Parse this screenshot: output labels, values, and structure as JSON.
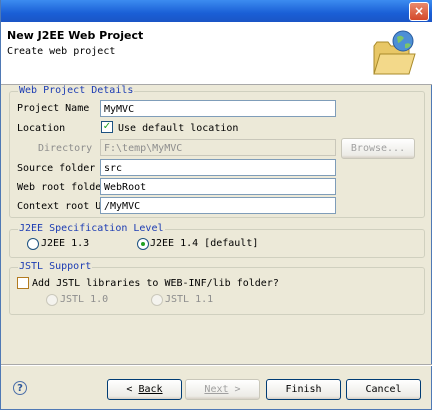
{
  "header": {
    "title": "New J2EE Web Project",
    "subtitle": "Create web project"
  },
  "details": {
    "group_label": "Web Project Details",
    "project_name_label": "Project Name",
    "project_name_value": "MyMVC",
    "location_label": "Location",
    "use_default_label": "Use default location",
    "directory_label": "Directory",
    "directory_value": "F:\\temp\\MyMVC",
    "browse_label": "Browse...",
    "source_folder_label": "Source folder",
    "source_folder_value": "src",
    "web_root_label": "Web root folder",
    "web_root_value": "WebRoot",
    "context_root_label": "Context root URL",
    "context_root_value": "/MyMVC"
  },
  "j2ee": {
    "group_label": "J2EE Specification Level",
    "opt_13": "J2EE 1.3",
    "opt_14": "J2EE 1.4 [default]"
  },
  "jstl": {
    "group_label": "JSTL Support",
    "add_label": "Add JSTL libraries to WEB-INF/lib folder?",
    "opt_10": "JSTL 1.0",
    "opt_11": "JSTL 1.1"
  },
  "buttons": {
    "back": "Back",
    "next": "Next",
    "finish": "Finish",
    "cancel": "Cancel"
  },
  "icons": {
    "close": "×",
    "help": "?",
    "check": "✓"
  }
}
